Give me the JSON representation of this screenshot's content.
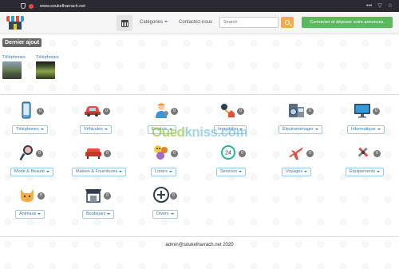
{
  "browser": {
    "url": "www.soukelharrach.net",
    "menu_glyph": "•••",
    "pocket_glyph": "▽",
    "star_glyph": "☆"
  },
  "navbar": {
    "categories_label": "Catégories",
    "contact_label": "Contactez-nous",
    "search_placeholder": "Search",
    "login_label": "Connecter et déposer votre annonces."
  },
  "recent": {
    "title": "Dernier ajout",
    "items": [
      {
        "label": "Téléphones"
      },
      {
        "label": "Téléphones"
      }
    ]
  },
  "categories": [
    {
      "label": "Téléphones",
      "count": "0",
      "icon": "phone-icon"
    },
    {
      "label": "Véhicules",
      "count": "0",
      "icon": "car-icon"
    },
    {
      "label": "Emplois",
      "count": "0",
      "icon": "worker-icon"
    },
    {
      "label": "Immobilier",
      "count": "0",
      "icon": "house-key-icon"
    },
    {
      "label": "Électroménager",
      "count": "0",
      "icon": "appliance-icon"
    },
    {
      "label": "Informatique",
      "count": "0",
      "icon": "computer-icon"
    },
    {
      "label": "Mode & Beauté",
      "count": "0",
      "icon": "mirror-icon"
    },
    {
      "label": "Maison & Fournitures",
      "count": "0",
      "icon": "sofa-icon"
    },
    {
      "label": "Loisirs",
      "count": "0",
      "icon": "games-icon"
    },
    {
      "label": "Services",
      "count": "0",
      "icon": "clock-24-icon"
    },
    {
      "label": "Voyages",
      "count": "0",
      "icon": "airplane-icon"
    },
    {
      "label": "Equipements",
      "count": "0",
      "icon": "tools-icon"
    },
    {
      "label": "Animaux",
      "count": "0",
      "icon": "cat-icon"
    },
    {
      "label": "Boutiques",
      "count": "0",
      "icon": "shop-icon"
    },
    {
      "label": "Divers",
      "count": "0",
      "icon": "plus-circle-icon"
    }
  ],
  "watermark": {
    "part1": "Oued",
    "part2": "kniss",
    "part3": ".com"
  },
  "footer": {
    "text": "admin@soukelharrach.net 2020"
  }
}
